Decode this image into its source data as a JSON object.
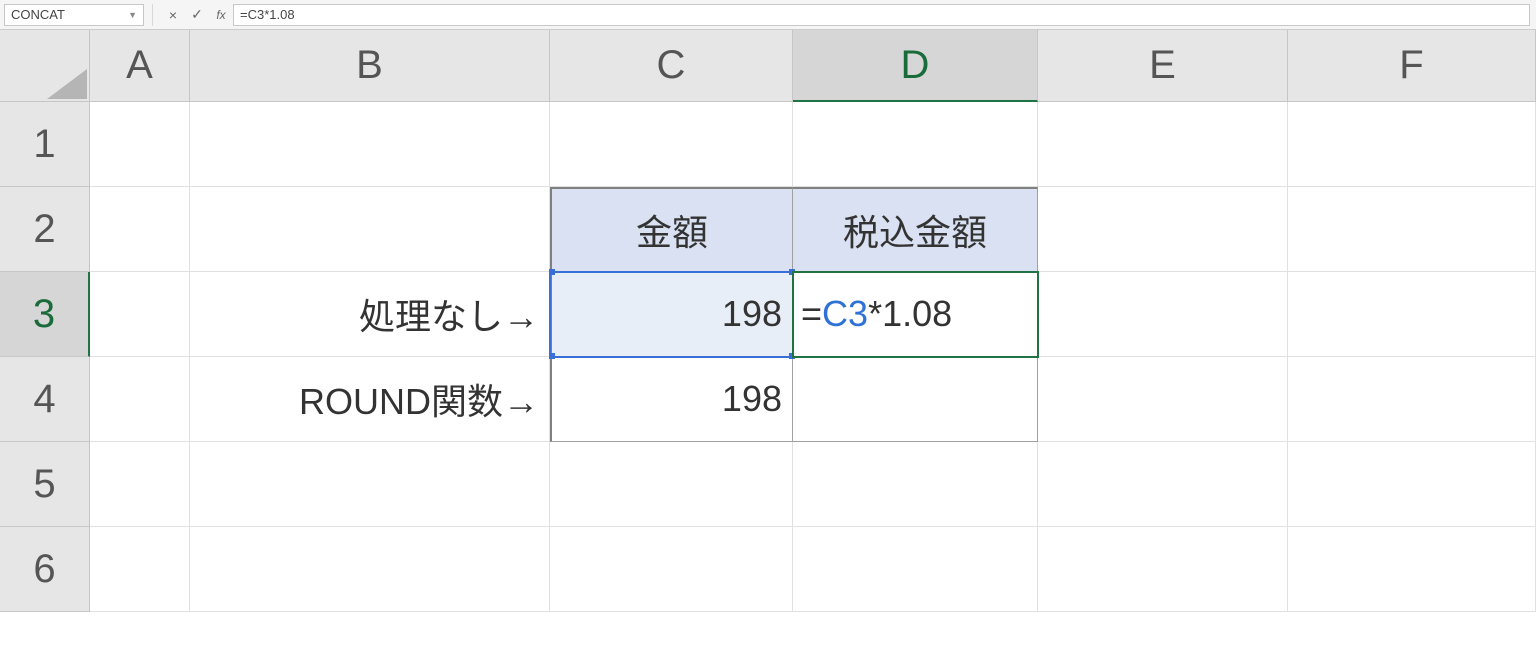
{
  "formula_bar": {
    "name_box": "CONCAT",
    "cancel_icon": "×",
    "enter_icon": "✓",
    "fx_label": "fx",
    "formula_text": "=C3*1.08"
  },
  "columns": [
    "A",
    "B",
    "C",
    "D",
    "E",
    "F"
  ],
  "rows": [
    "1",
    "2",
    "3",
    "4",
    "5",
    "6"
  ],
  "active_column": "D",
  "active_row": "3",
  "cells": {
    "C2": "金額",
    "D2": "税込金額",
    "B3": "処理なし→",
    "C3": "198",
    "D3_formula": {
      "eq": "=",
      "ref": "C3",
      "rest": "*1.08"
    },
    "B4": "ROUND関数→",
    "C4": "198"
  }
}
